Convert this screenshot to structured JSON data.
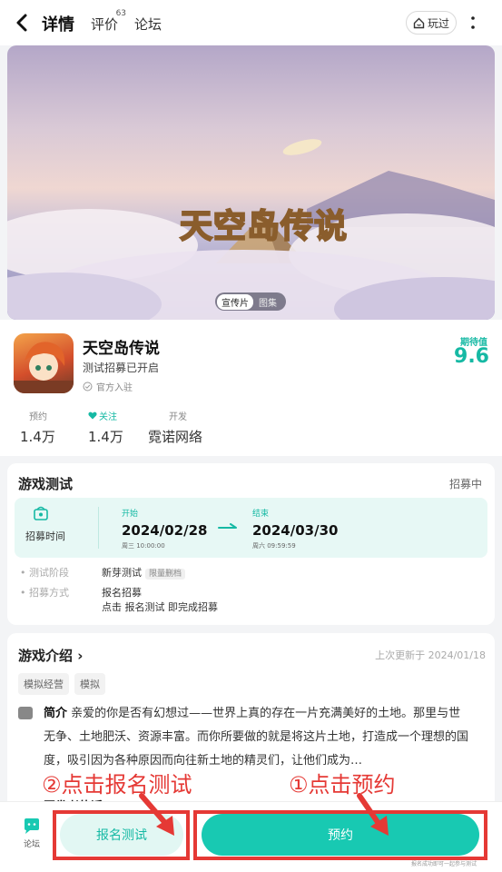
{
  "topbar": {
    "tabs": {
      "detail": "详情",
      "review": "评价",
      "review_count": "63",
      "forum": "论坛"
    },
    "played_label": "玩过"
  },
  "banner": {
    "game_logo_text": "天空岛传说",
    "toggle_active": "宣传片",
    "toggle_inactive": "图集"
  },
  "game": {
    "name": "天空岛传说",
    "status": "测试招募已开启",
    "official": "官方入驻",
    "rating_label": "期待值",
    "rating": "9.6",
    "stats": [
      {
        "label": "预约",
        "value": "1.4万"
      },
      {
        "label": "关注",
        "value": "1.4万"
      },
      {
        "label": "开发",
        "value": "霓诺网络"
      }
    ]
  },
  "test": {
    "title": "游戏测试",
    "status": "招募中",
    "period_label": "招募时间",
    "start_caption": "开始",
    "start_date": "2024/02/28",
    "start_time": "周三 10:00:00",
    "end_caption": "结束",
    "end_date": "2024/03/30",
    "end_time": "周六 09:59:59",
    "stage_key": "测试阶段",
    "stage_value": "新芽测试",
    "stage_tag": "限量删档",
    "method_key": "招募方式",
    "method_value": "报名招募",
    "method_hint": "点击 报名测试 即完成招募"
  },
  "intro": {
    "title": "游戏介绍",
    "updated": "上次更新于 2024/01/18",
    "tags": [
      "模拟经营",
      "模拟"
    ],
    "brief_label": "简介",
    "brief_text": "亲爱的你是否有幻想过——世界上真的存在一片充满美好的土地。那里与世无争、土地肥沃、资源丰富。而你所要做的就是将这片土地，打造成一个理想的国度，吸引因为各种原因而向往新土地的精灵们，让他们成为…",
    "developer_line": "开发者的话"
  },
  "bottombar": {
    "forum_label": "论坛",
    "register_label": "报名测试",
    "book_label": "预约",
    "note": "报名成功即可一起参与测试"
  },
  "annotations": {
    "step1": "①点击预约",
    "step2": "②点击报名测试",
    "color": "#e53935"
  },
  "colors": {
    "accent": "#16b9a4",
    "button": "#18c9b2"
  }
}
